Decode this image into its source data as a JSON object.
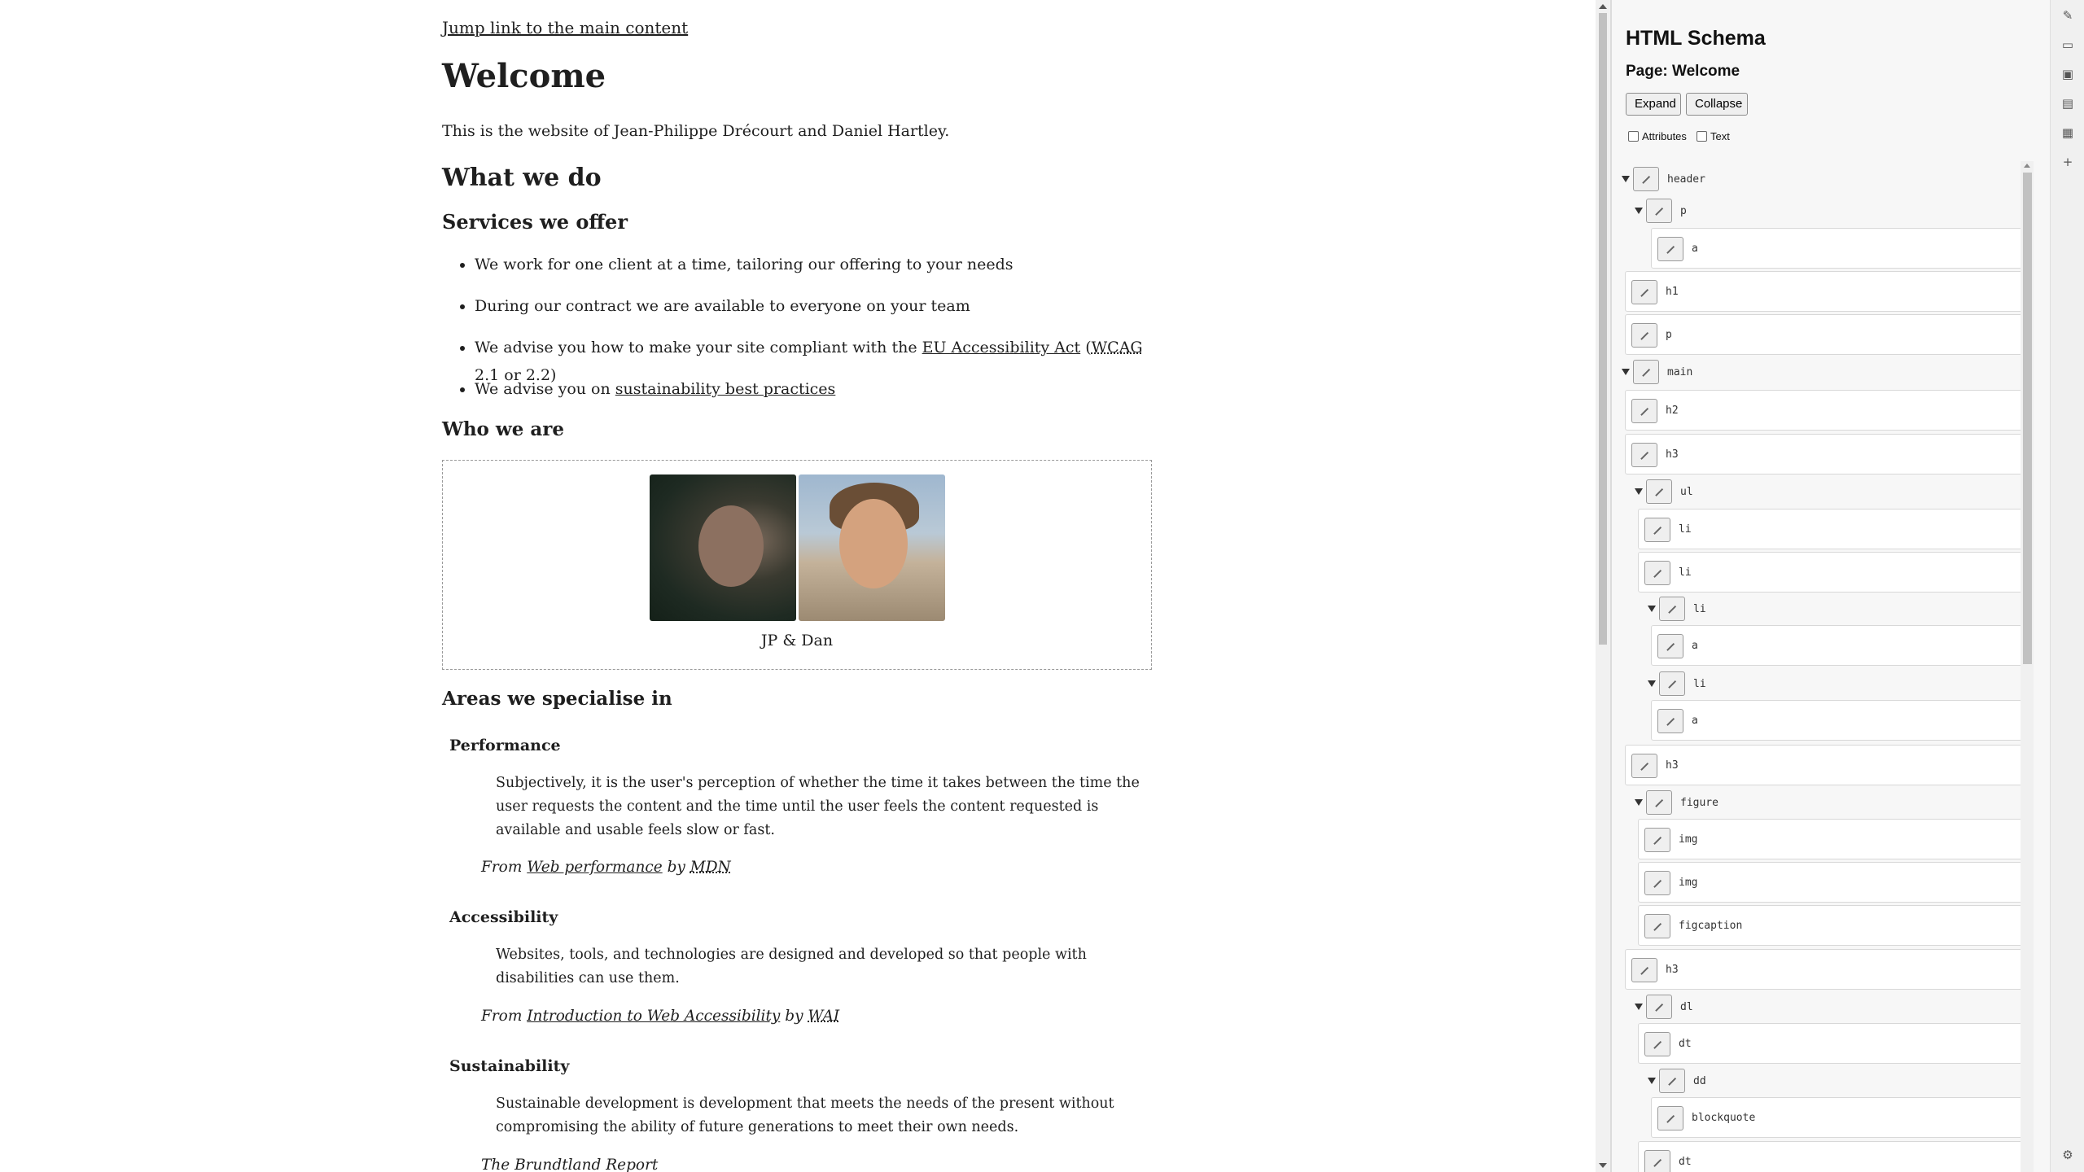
{
  "page": {
    "skip_link": "Jump link to the main content",
    "heading": "Welcome",
    "intro": "This is the website of Jean-Philippe Drécourt and Daniel Hartley.",
    "what_heading": "What we do",
    "services_heading": "Services we offer",
    "services": {
      "item1": "We work for one client at a time, tailoring our offering to your needs",
      "item2": "During our contract we are available to everyone on your team",
      "item3_pre": "We advise you how to make your site compliant with the ",
      "item3_link": "EU Accessibility Act",
      "item3_mid": " (",
      "item3_abbr": "WCAG",
      "item3_post": " 2.1 or 2.2)",
      "item4_pre": "We advise you on ",
      "item4_link": "sustainability best practices"
    },
    "who_heading": "Who we are",
    "figcaption": "JP & Dan",
    "areas_heading": "Areas we specialise in",
    "areas": {
      "performance": {
        "term": "Performance",
        "quote": "Subjectively, it is the user's perception of whether the time it takes between the time the user requests the content and the time until the user feels the content requested is available and usable feels slow or fast.",
        "from": "From ",
        "source_link": "Web performance",
        "by": " by ",
        "org": "MDN"
      },
      "accessibility": {
        "term": "Accessibility",
        "quote": "Websites, tools, and technologies are designed and developed so that people with disabilities can use them.",
        "from": "From ",
        "source_link": "Introduction to Web Accessibility",
        "by": " by ",
        "org": "WAI"
      },
      "sustainability": {
        "term": "Sustainability",
        "quote": "Sustainable development is development that meets the needs of the present without compromising the ability of future generations to meet their own needs.",
        "source": "The Brundtland Report"
      }
    }
  },
  "panel": {
    "title": "HTML Schema",
    "page_label": "Page: Welcome",
    "expand": "Expand",
    "collapse": "Collapse",
    "attributes": "Attributes",
    "text": "Text",
    "tree": [
      "header",
      "p",
      "a",
      "h1",
      "p",
      "main",
      "h2",
      "h3",
      "ul",
      "li",
      "li",
      "li",
      "a",
      "li",
      "a",
      "h3",
      "figure",
      "img",
      "img",
      "figcaption",
      "h3",
      "dl",
      "dt",
      "dd",
      "blockquote",
      "dt"
    ]
  },
  "toolbar": {
    "icons": [
      "pin-icon",
      "reader-icon",
      "wallet-icon",
      "save-icon",
      "table-icon",
      "plus-icon",
      "settings-icon"
    ]
  }
}
